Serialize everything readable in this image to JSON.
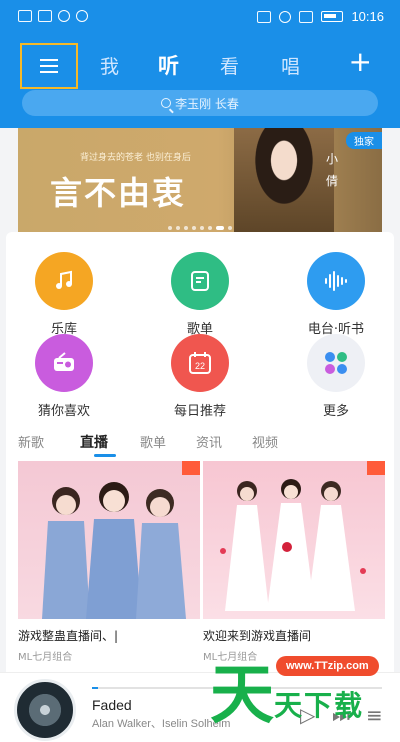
{
  "status_bar": {
    "time": "10:16"
  },
  "header": {
    "tabs": [
      {
        "label": "我"
      },
      {
        "label": "听"
      },
      {
        "label": "看"
      },
      {
        "label": "唱"
      }
    ],
    "active_tab": "听",
    "plus_label": "+",
    "search_placeholder": "李玉刚 长春"
  },
  "banner": {
    "small_text": "背过身去的苍老 也别在身后",
    "big_text": "言不由衷",
    "artist_vertical": "小倩",
    "badge": "独家",
    "page_count": 8,
    "current_page": 7
  },
  "shortcuts": [
    {
      "label": "乐库",
      "icon": "music-note-icon",
      "color": "#f5a623"
    },
    {
      "label": "歌单",
      "icon": "playlist-icon",
      "color": "#2fbd84"
    },
    {
      "label": "电台·听书",
      "icon": "sound-wave-icon",
      "color": "#2e9cf0"
    },
    {
      "label": "猜你喜欢",
      "icon": "radio-icon",
      "color": "#c95cde"
    },
    {
      "label": "每日推荐",
      "icon": "calendar-icon",
      "color": "#f0564f"
    },
    {
      "label": "更多",
      "icon": "more-apps-icon",
      "color": "#eef0f5"
    }
  ],
  "calendar_day": "22",
  "sub_tabs": [
    {
      "label": "新歌"
    },
    {
      "label": "直播"
    },
    {
      "label": "歌单"
    },
    {
      "label": "资讯"
    },
    {
      "label": "视频"
    }
  ],
  "active_sub_tab": "直播",
  "cards": [
    {
      "title": "游戏整蛊直播间、|",
      "subtitle": "ML七月组合"
    },
    {
      "title": "欢迎来到游戏直播间",
      "subtitle": "ML七月组合"
    }
  ],
  "player": {
    "song": "Faded",
    "artist": "Alan Walker、Iselin Solheim",
    "progress": 0.02
  },
  "watermark": {
    "url": "www.TTzip.com",
    "big_char": "天",
    "text": "天下载"
  },
  "colors": {
    "brand_blue": "#1a8fe8",
    "accent_orange": "#f5b928"
  }
}
